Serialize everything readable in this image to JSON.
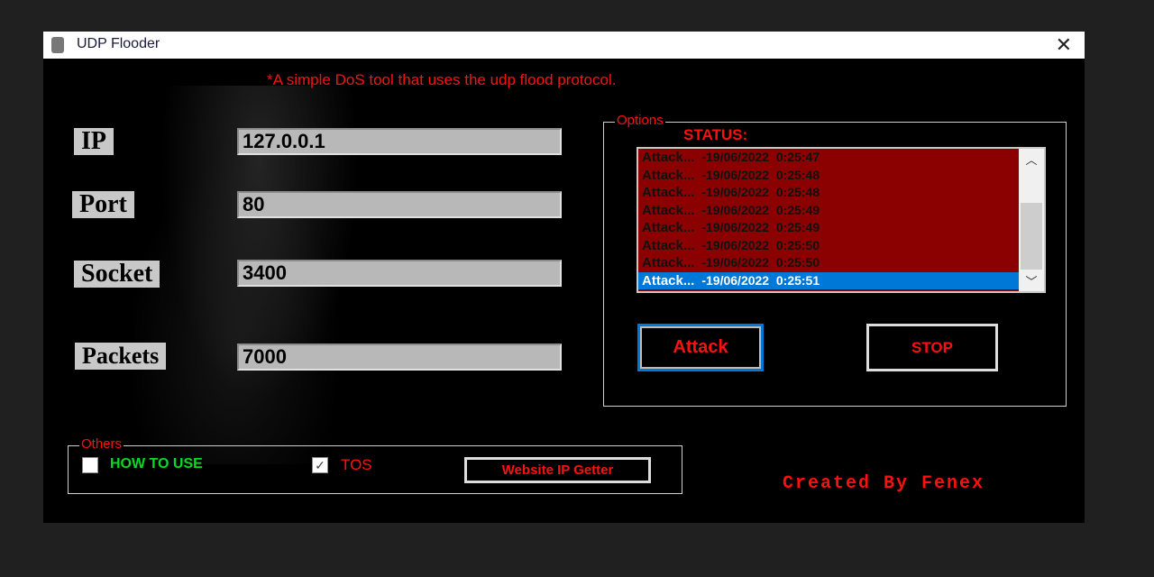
{
  "window": {
    "title": "UDP Flooder",
    "close_icon": "close-icon"
  },
  "tagline": "*A simple DoS tool that uses the udp flood protocol.",
  "fields": [
    {
      "label": "IP",
      "value": "127.0.0.1"
    },
    {
      "label": "Port",
      "value": "80"
    },
    {
      "label": "Socket",
      "value": "3400"
    },
    {
      "label": "Packets",
      "value": "7000"
    }
  ],
  "options": {
    "legend": "Options",
    "status_label": "STATUS:",
    "log": [
      {
        "msg": "Attack...",
        "ts": "-19/06/2022  0:25:47"
      },
      {
        "msg": "Attack...",
        "ts": "-19/06/2022  0:25:48"
      },
      {
        "msg": "Attack...",
        "ts": "-19/06/2022  0:25:48"
      },
      {
        "msg": "Attack...",
        "ts": "-19/06/2022  0:25:49"
      },
      {
        "msg": "Attack...",
        "ts": "-19/06/2022  0:25:49"
      },
      {
        "msg": "Attack...",
        "ts": "-19/06/2022  0:25:50"
      },
      {
        "msg": "Attack...",
        "ts": "-19/06/2022  0:25:50"
      },
      {
        "msg": "Attack...",
        "ts": "-19/06/2022  0:25:51",
        "selected": true
      }
    ],
    "attack_label": "Attack",
    "stop_label": "STOP"
  },
  "others": {
    "legend": "Others",
    "how_to_use": {
      "label": "HOW TO USE",
      "checked": false
    },
    "tos": {
      "label": "TOS",
      "checked": true
    },
    "website_ip_getter": "Website IP Getter"
  },
  "credit": "Created By Fenex",
  "colors": {
    "accent": "#ff1010",
    "list_bg": "#8b0000",
    "selection": "#0078d7",
    "how_to_use": "#00dd22"
  }
}
